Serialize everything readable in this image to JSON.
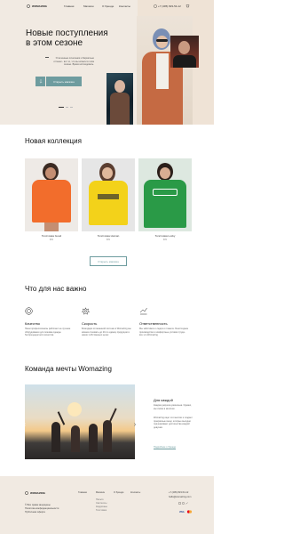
{
  "header": {
    "logo": "WOMAZING",
    "nav": [
      "Главная",
      "Магазин",
      "О бренде",
      "Контакты"
    ],
    "phone": "+7 (495) 823-54-12",
    "cart_count": "0"
  },
  "hero": {
    "title": "Новые поступления в этом сезоне",
    "text": "Утонченные сочетания и бархатные оттенки - вот то, что вы искали в этом сезоне. Время исследовать.",
    "button": "Открыть магазин"
  },
  "collection": {
    "title": "Новая коллекция",
    "products": [
      {
        "name": "Толстовка Good",
        "price": "$99",
        "color": "#f26d2c"
      },
      {
        "name": "Толстовка Human",
        "price": "$99",
        "color": "#f3d21a"
      },
      {
        "name": "Толстовка Lucky",
        "price": "$99",
        "color": "#2a9a47"
      }
    ],
    "button": "Открыть магазин"
  },
  "features": {
    "title": "Что для нас важно",
    "items": [
      {
        "icon": "quality-icon",
        "title": "Качество",
        "text": "Наши профессионалы работают на лучшем оборудовании для пошива одежды беспрецедентного качества"
      },
      {
        "icon": "speed-icon",
        "title": "Скорость",
        "text": "Благодаря отлаженной системе в Womazing мы можем отшивать до 20-ти единиц продукции в наших собственных цехах"
      },
      {
        "icon": "responsibility-icon",
        "title": "Ответственность",
        "text": "Мы заботимся о людях и планете. Безотходное производство и комфортные условия труда - все это Womazing"
      }
    ]
  },
  "team": {
    "title": "Команда мечты Womazing",
    "subtitle": "Для каждой",
    "p1": "Каждая девушка уникальна. Однако, мы схожи в мелочах.",
    "p2": "Womazing ищет эти мелочи и создает прекрасные вещи, которые выгодно подчеркивают достоинства каждой девушки.",
    "link": "Подробнее о бренде"
  },
  "footer": {
    "logo": "WOMAZING",
    "copyright": "© Все права защищены",
    "policy": "Политика конфиденциальности",
    "offer": "Публичная оферта",
    "nav": [
      "Главная",
      "Магазин",
      "О бренде",
      "Контакты"
    ],
    "shop_links": [
      "Пальто",
      "Свитшоты",
      "Кардиганы",
      "Толстовки"
    ],
    "phone": "+7 (495) 823-54-12",
    "email": "hello@womazing.com",
    "payments": [
      "VISA",
      "MC"
    ]
  },
  "colors": {
    "accent": "#6e9c9f",
    "beige": "#f1eae2"
  }
}
